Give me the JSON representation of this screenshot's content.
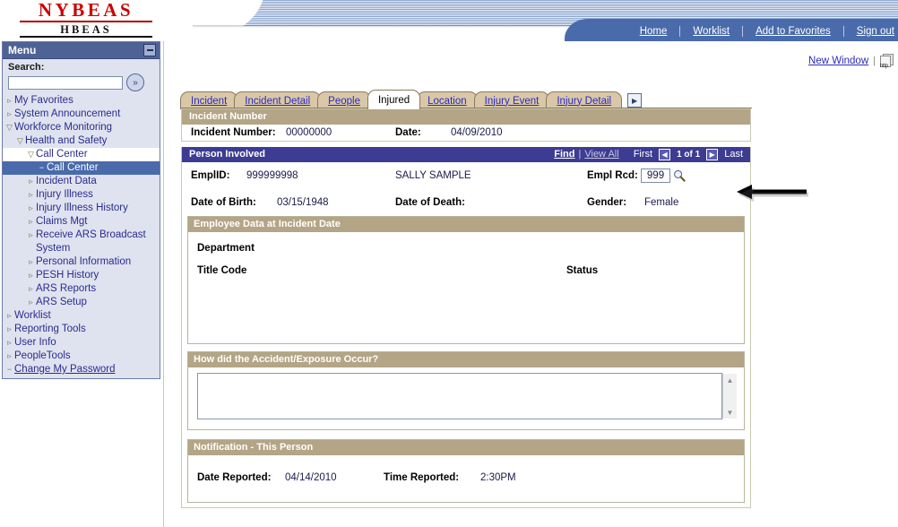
{
  "branding": {
    "logo_main": "NYBEAS",
    "logo_sub": "HBEAS"
  },
  "topnav": {
    "items": [
      {
        "label": "Home",
        "icon": "home-link"
      },
      {
        "label": "Worklist",
        "icon": "worklist-link"
      },
      {
        "label": "Add to Favorites",
        "icon": "favorites-link"
      },
      {
        "label": "Sign out",
        "icon": "signout-link"
      }
    ]
  },
  "sidebar": {
    "title": "Menu",
    "minimize_label": "−",
    "search_label": "Search:",
    "search_value": "",
    "search_placeholder": "",
    "search_go_glyph": "»",
    "items": [
      {
        "label": "My Favorites",
        "level": 1,
        "caret": "▹",
        "state": "collapsed"
      },
      {
        "label": "System Announcement",
        "level": 1,
        "caret": "▹",
        "state": "collapsed"
      },
      {
        "label": "Workforce Monitoring",
        "level": 1,
        "caret": "▽",
        "state": "expanded"
      },
      {
        "label": "Health and Safety",
        "level": 2,
        "caret": "▽",
        "state": "expanded"
      },
      {
        "label": "Call Center",
        "level": 3,
        "caret": "▽",
        "state": "expanded-white"
      },
      {
        "label": "Call Center",
        "level": 4,
        "caret": "−",
        "state": "selected"
      },
      {
        "label": "Incident Data",
        "level": 3,
        "caret": "▹",
        "state": "collapsed"
      },
      {
        "label": "Injury Illness",
        "level": 3,
        "caret": "▹",
        "state": "collapsed"
      },
      {
        "label": "Injury Illness History",
        "level": 3,
        "caret": "▹",
        "state": "collapsed"
      },
      {
        "label": "Claims Mgt",
        "level": 3,
        "caret": "▹",
        "state": "collapsed"
      },
      {
        "label": "Receive ARS Broadcast System",
        "level": 3,
        "caret": "▹",
        "state": "collapsed",
        "wrap": true
      },
      {
        "label": "Personal Information",
        "level": 3,
        "caret": "▹",
        "state": "collapsed"
      },
      {
        "label": "PESH History",
        "level": 3,
        "caret": "▹",
        "state": "collapsed"
      },
      {
        "label": "ARS Reports",
        "level": 3,
        "caret": "▹",
        "state": "collapsed"
      },
      {
        "label": "ARS Setup",
        "level": 3,
        "caret": "▹",
        "state": "collapsed"
      },
      {
        "label": "Worklist",
        "level": 1,
        "caret": "▹",
        "state": "collapsed"
      },
      {
        "label": "Reporting Tools",
        "level": 1,
        "caret": "▹",
        "state": "collapsed"
      },
      {
        "label": "User Info",
        "level": 1,
        "caret": "▹",
        "state": "collapsed"
      },
      {
        "label": "PeopleTools",
        "level": 1,
        "caret": "▹",
        "state": "collapsed"
      },
      {
        "label": "Change My Password",
        "level": 1,
        "caret": "−",
        "state": "link"
      }
    ]
  },
  "page_links": {
    "new_window": "New Window",
    "separator": "|",
    "help_icon_text": "http"
  },
  "tabs": {
    "items": [
      {
        "label": "Incident",
        "active": false
      },
      {
        "label": "Incident Detail",
        "active": false
      },
      {
        "label": "People",
        "active": false
      },
      {
        "label": "Injured",
        "active": true
      },
      {
        "label": "Location",
        "active": false
      },
      {
        "label": "Injury Event",
        "active": false
      },
      {
        "label": "Injury Detail",
        "active": false
      }
    ],
    "more_glyph": "▶"
  },
  "incident_number_section": {
    "header": "Incident Number",
    "fields": [
      {
        "label": "Incident Number:",
        "value": "00000000"
      },
      {
        "label": "Date:",
        "value": "04/09/2010"
      }
    ]
  },
  "person_involved_section": {
    "header": "Person Involved",
    "find_label": "Find",
    "pipe": "|",
    "view_all_label": "View All",
    "first_label": "First",
    "prev_glyph": "◀",
    "counter": "1 of 1",
    "next_glyph": "▶",
    "last_label": "Last",
    "emplid_label": "EmplID:",
    "emplid_value": "999999998",
    "person_name": "SALLY SAMPLE",
    "empl_rcd_label": "Empl Rcd:",
    "empl_rcd_value": "999",
    "lookup_icon": "magnifying-glass",
    "dob_label": "Date of Birth:",
    "dob_value": "03/15/1948",
    "dod_label": "Date of Death:",
    "dod_value": "",
    "gender_label": "Gender:",
    "gender_value": "Female"
  },
  "employee_data_section": {
    "header": "Employee Data at Incident Date",
    "department_label": "Department",
    "department_value": "",
    "title_code_label": "Title Code",
    "title_code_value": "",
    "status_label": "Status",
    "status_value": ""
  },
  "accident_section": {
    "header": "How did the Accident/Exposure Occur?",
    "textarea_value": "",
    "scroll_up_glyph": "▲",
    "scroll_down_glyph": "▼"
  },
  "notification_section": {
    "header": "Notification - This Person",
    "date_reported_label": "Date Reported:",
    "date_reported_value": "04/14/2010",
    "time_reported_label": "Time Reported:",
    "time_reported_value": "2:30PM"
  },
  "annotation": {
    "arrow": "black-left-arrow-pointing-to-lookup-icon"
  },
  "colors": {
    "nav_blue": "#4a6bab",
    "menu_header": "#4f6295",
    "tab_tan": "#d9c7a7",
    "group_header_tan": "#b3a585",
    "group_header_blue": "#3c3c93",
    "link_blue": "#2b2bbf",
    "logo_red": "#cc0000"
  }
}
